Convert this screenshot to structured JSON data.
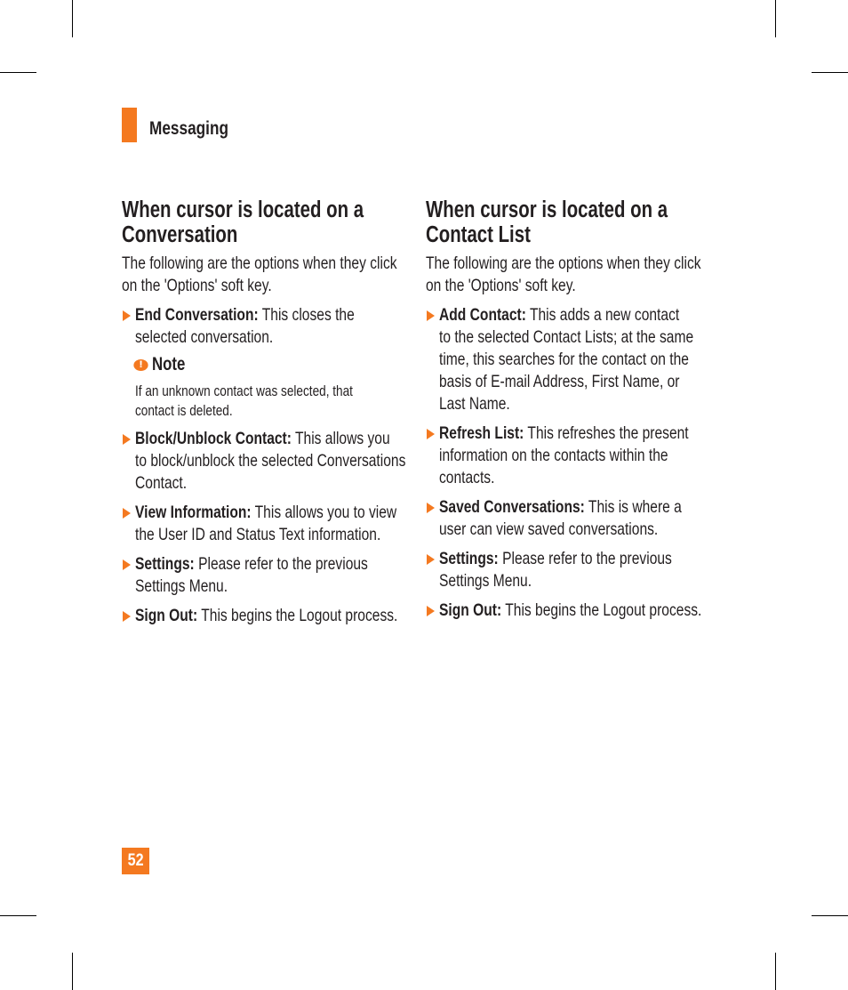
{
  "header": {
    "section_title": "Messaging"
  },
  "left_column": {
    "heading_lines": [
      "When cursor is located on a",
      "Conversation"
    ],
    "intro_lines": [
      "The following are the options when they click",
      "on the 'Options' soft key."
    ],
    "items": [
      {
        "label": "End Conversation:",
        "first_line_rest": " This closes the",
        "lines": [
          "selected conversation."
        ]
      },
      {
        "label": "Block/Unblock Contact:",
        "first_line_rest": " This allows you",
        "lines": [
          "to block/unblock the selected Conversations",
          "Contact."
        ]
      },
      {
        "label": "View Information:",
        "first_line_rest": " This allows you to view",
        "lines": [
          "the User ID and Status Text information."
        ]
      },
      {
        "label": "Settings:",
        "first_line_rest": " Please refer to the previous",
        "lines": [
          "Settings Menu."
        ]
      },
      {
        "label": "Sign Out:",
        "first_line_rest": " This begins the Logout process.",
        "lines": []
      }
    ],
    "note": {
      "icon": "exclamation-icon",
      "title": "Note",
      "lines": [
        "If an unknown contact was selected, that",
        "contact is deleted."
      ]
    }
  },
  "right_column": {
    "heading_lines": [
      "When cursor is located on a",
      "Contact List"
    ],
    "intro_lines": [
      "The following are the options when they click",
      "on the 'Options' soft key."
    ],
    "items": [
      {
        "label": "Add Contact:",
        "first_line_rest": " This adds a new contact",
        "lines": [
          "to the selected Contact Lists; at the same",
          "time, this searches for the contact on the",
          "basis of E-mail Address, First Name, or",
          "Last Name."
        ]
      },
      {
        "label": "Refresh List:",
        "first_line_rest": " This refreshes the present",
        "lines": [
          "information on the contacts within the",
          "contacts."
        ]
      },
      {
        "label": "Saved Conversations:",
        "first_line_rest": " This is where a",
        "lines": [
          "user can view saved conversations."
        ]
      },
      {
        "label": "Settings:",
        "first_line_rest": " Please refer to the previous",
        "lines": [
          "Settings Menu."
        ]
      },
      {
        "label": "Sign Out:",
        "first_line_rest": " This begins the Logout process.",
        "lines": []
      }
    ]
  },
  "footer": {
    "page_number": "52"
  },
  "colors": {
    "accent": "#f47920",
    "text": "#231f20"
  }
}
